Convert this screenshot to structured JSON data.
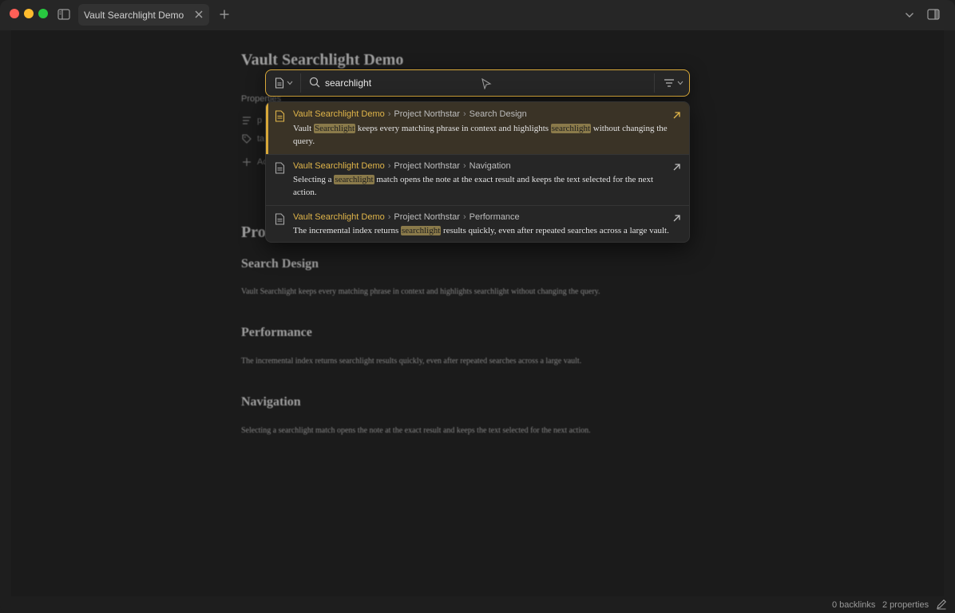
{
  "tab": {
    "title": "Vault Searchlight Demo"
  },
  "note": {
    "title": "Vault Searchlight Demo",
    "properties_label": "Properties",
    "property_rows": [
      {
        "label": "p"
      },
      {
        "label": "ta"
      }
    ],
    "add_property_label": "Ac",
    "partial_heading": "Pro",
    "sections": [
      {
        "heading": "Search Design",
        "text": "Vault Searchlight keeps every matching phrase in context and highlights searchlight without changing the query."
      },
      {
        "heading": "Performance",
        "text": "The incremental index returns searchlight results quickly, even after repeated searches across a large vault."
      },
      {
        "heading": "Navigation",
        "text": "Selecting a searchlight match opens the note at the exact result and keeps the text selected for the next action."
      }
    ]
  },
  "search": {
    "query": "searchlight",
    "results": [
      {
        "vault": "Vault Searchlight Demo",
        "folder": "Project Northstar",
        "section": "Search Design",
        "before": "Vault ",
        "match1": "Searchlight",
        "middle": " keeps every matching phrase in context and highlights ",
        "match2": "searchlight",
        "after": " without changing the query."
      },
      {
        "vault": "Vault Searchlight Demo",
        "folder": "Project Northstar",
        "section": "Navigation",
        "before": "Selecting a ",
        "match1": "searchlight",
        "after": " match opens the note at the exact result and keeps the text selected for the next action."
      },
      {
        "vault": "Vault Searchlight Demo",
        "folder": "Project Northstar",
        "section": "Performance",
        "before": "The incremental index returns ",
        "match1": "searchlight",
        "after": " results quickly, even after repeated searches across a large vault."
      }
    ]
  },
  "status": {
    "backlinks": "0 backlinks",
    "properties": "2 properties"
  },
  "colors": {
    "accent": "#d8a839",
    "highlight": "#8a7a4a",
    "vault_crumb": "#e0b54a"
  },
  "icons": {
    "scope": "document-icon",
    "search": "search-icon",
    "filter": "filter-icon",
    "open": "arrow-up-right-icon",
    "edit": "pencil-icon"
  }
}
